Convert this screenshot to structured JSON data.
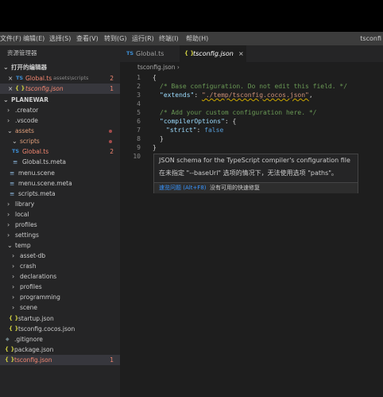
{
  "window": {
    "title": "tsconfi"
  },
  "menu": [
    "文件(F)",
    "编辑(E)",
    "选择(S)",
    "查看(V)",
    "转到(G)",
    "运行(R)",
    "终端(I)",
    "帮助(H)"
  ],
  "sidebar": {
    "header": "资源管理器",
    "open_editors_title": "打开的编辑器",
    "open_editors": [
      {
        "name": "Global.ts",
        "path": "assets\\scripts",
        "badge": "2",
        "icon": "TS"
      },
      {
        "name": "tsconfig.json",
        "badge": "1",
        "icon": "{ }"
      }
    ],
    "project_title": "PLANEWAR",
    "tree": [
      {
        "label": ".creator",
        "chev": "›"
      },
      {
        "label": ".vscode",
        "chev": "›"
      },
      {
        "label": "assets",
        "chev": "⌄"
      },
      {
        "label": "scripts",
        "chev": "⌄"
      },
      {
        "label": "Global.ts",
        "badge": "2",
        "icon": "TS"
      },
      {
        "label": "Global.ts.meta",
        "icon": "≡"
      },
      {
        "label": "menu.scene",
        "icon": "≡"
      },
      {
        "label": "menu.scene.meta",
        "icon": "≡"
      },
      {
        "label": "scripts.meta",
        "icon": "≡"
      },
      {
        "label": "library",
        "chev": "›"
      },
      {
        "label": "local",
        "chev": "›"
      },
      {
        "label": "profiles",
        "chev": "›"
      },
      {
        "label": "settings",
        "chev": "›"
      },
      {
        "label": "temp",
        "chev": "⌄"
      },
      {
        "label": "asset-db",
        "chev": "›"
      },
      {
        "label": "crash",
        "chev": "›"
      },
      {
        "label": "declarations",
        "chev": "›"
      },
      {
        "label": "profiles",
        "chev": "›"
      },
      {
        "label": "programming",
        "chev": "›"
      },
      {
        "label": "scene",
        "chev": "›"
      },
      {
        "label": "startup.json",
        "icon": "{ }"
      },
      {
        "label": "tsconfig.cocos.json",
        "icon": "{ }"
      },
      {
        "label": ".gitignore",
        "icon": "◆"
      },
      {
        "label": "package.json",
        "icon": "{ }"
      },
      {
        "label": "tsconfig.json",
        "badge": "1",
        "icon": "{ }"
      }
    ]
  },
  "editor": {
    "tabs": [
      {
        "label": "Global.ts",
        "icon": "TS"
      },
      {
        "label": "tsconfig.json",
        "icon": "{ }"
      }
    ],
    "close_glyph": "×",
    "breadcrumb": "tsconfig.json ›",
    "line_numbers": [
      "1",
      "2",
      "3",
      "4",
      "5",
      "6",
      "7",
      "8",
      "9",
      "10"
    ],
    "code": {
      "l1": "{",
      "l2_comment": "/* Base configuration. Do not edit this field. */",
      "l3_key": "\"extends\"",
      "l3_sep": ": ",
      "l3_val": "\"./temp/tsconfig.cocos.json\"",
      "l3_end": ",",
      "l5_comment": "/* Add your custom configuration here. */",
      "l6_key": "\"compilerOptions\"",
      "l6_rest": ": {",
      "l7_key": "\"strict\"",
      "l7_sep": ": ",
      "l7_val": "false",
      "l8": "}",
      "l9": "}"
    }
  },
  "hover": {
    "title": "JSON schema for the TypeScript compiler's configuration file",
    "message": "在未指定 \"--baseUrl\" 选项的情况下，无法使用选项 \"paths\"。",
    "quick_fix_link": "速览问题 (Alt+F8)",
    "no_fix": "没有可用的快速修复"
  }
}
